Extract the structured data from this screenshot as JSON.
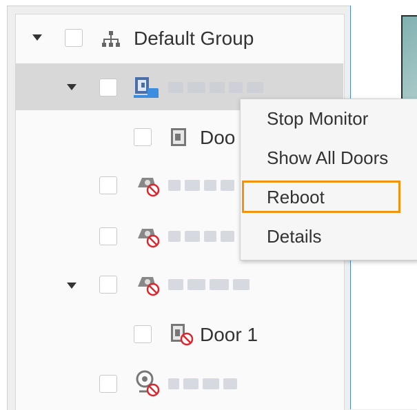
{
  "tree": {
    "root": {
      "label": "Default Group"
    },
    "door_leaf_partial": {
      "label": "Doo"
    },
    "door_leaf_1": {
      "label": "Door 1"
    }
  },
  "context_menu": {
    "items": [
      {
        "label": "Stop Monitor"
      },
      {
        "label": "Show All Doors"
      },
      {
        "label": "Reboot"
      },
      {
        "label": "Details"
      }
    ]
  },
  "colors": {
    "highlight_border": "#f0940f",
    "selected_row": "#d8d8d8",
    "offline_badge": "#e0242c"
  }
}
